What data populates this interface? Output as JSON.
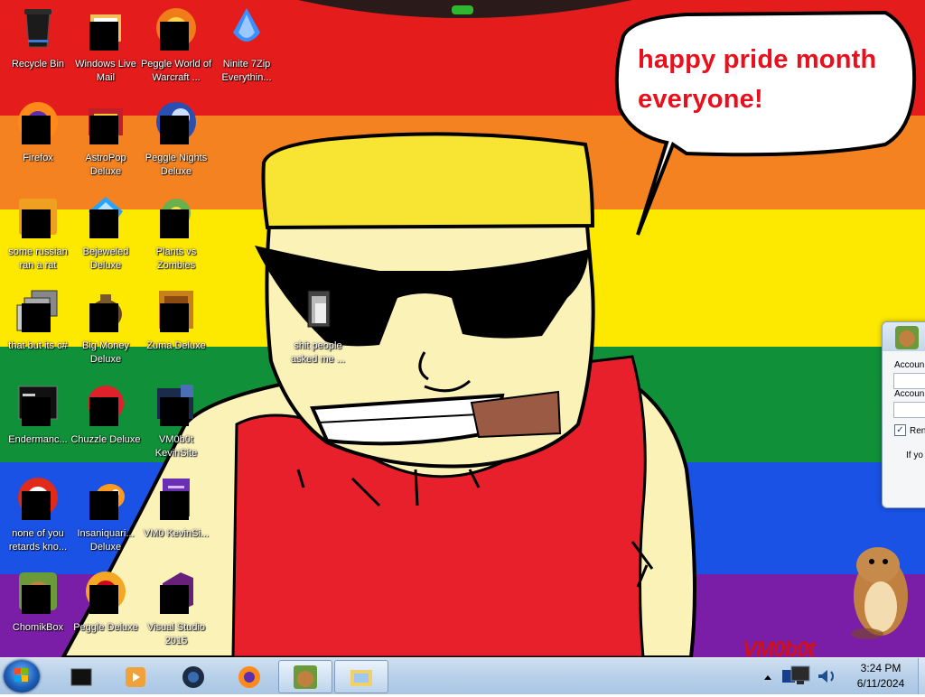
{
  "desktop": {
    "icons": [
      {
        "label": "Recycle Bin",
        "icon": "recycle-bin-icon",
        "masked": false
      },
      {
        "label": "Windows Live Mail",
        "icon": "windows-live-mail-icon",
        "masked": true
      },
      {
        "label": "Peggle World of Warcraft ...",
        "icon": "peggle-wow-icon",
        "masked": true
      },
      {
        "label": "Ninite 7Zip Everythin...",
        "icon": "ninite-icon",
        "masked": false
      },
      {
        "label": "Firefox",
        "icon": "firefox-icon",
        "masked": true
      },
      {
        "label": "AstroPop Deluxe",
        "icon": "astropop-icon",
        "masked": true
      },
      {
        "label": "Peggle Nights Deluxe",
        "icon": "peggle-nights-icon",
        "masked": true
      },
      {
        "label": "some russian ran a rat",
        "icon": "rat-program-icon",
        "masked": true
      },
      {
        "label": "Bejeweled Deluxe",
        "icon": "bejeweled-icon",
        "masked": true
      },
      {
        "label": "Plants vs Zombies",
        "icon": "plants-vs-zombies-icon",
        "masked": true
      },
      {
        "label": "that but its c#",
        "icon": "shortcut-stack-icon",
        "masked": true
      },
      {
        "label": "Big Money Deluxe",
        "icon": "big-money-icon",
        "masked": true
      },
      {
        "label": "Zuma Deluxe",
        "icon": "zuma-icon",
        "masked": true
      },
      {
        "label": "Endermanc...",
        "icon": "terminal-window-icon",
        "masked": true
      },
      {
        "label": "Chuzzle Deluxe",
        "icon": "chuzzle-icon",
        "masked": true
      },
      {
        "label": "VM0b0t KevinSite",
        "icon": "vm0b0t-icon",
        "masked": true
      },
      {
        "label": "none of you retards kno...",
        "icon": "red-circle-app-icon",
        "masked": true
      },
      {
        "label": "Insaniquari... Deluxe",
        "icon": "insaniquarium-icon",
        "masked": true
      },
      {
        "label": "VM0 KevinSi...",
        "icon": "purple-document-icon",
        "masked": true
      },
      {
        "label": "ChomikBox",
        "icon": "chomikbox-icon",
        "masked": true
      },
      {
        "label": "Peggle Deluxe",
        "icon": "peggle-deluxe-icon",
        "masked": true
      },
      {
        "label": "Visual Studio 2015",
        "icon": "visual-studio-icon",
        "masked": true
      },
      {
        "label": "shit people asked me ...",
        "icon": "folder-icon",
        "masked": false
      }
    ]
  },
  "wallpaper": {
    "speech_bubble_text_line1": "happy pride month",
    "speech_bubble_text_line2": "everyone!",
    "signature": "VM0b0t",
    "stripe_colors": [
      "#e41c1c",
      "#f58220",
      "#fde800",
      "#109038",
      "#1a52e6",
      "#7a1ea8"
    ]
  },
  "dialog": {
    "field1_label": "Accoun",
    "field2_label": "Accoun",
    "checkbox_label": "Ren",
    "checkbox_checked": true,
    "footer_text": "If yo"
  },
  "taskbar": {
    "pinned": [
      {
        "name": "taskbar-item-terminal",
        "icon": "black-window-icon"
      },
      {
        "name": "taskbar-item-media-player",
        "icon": "media-player-icon"
      },
      {
        "name": "taskbar-item-generic-app",
        "icon": "dark-globe-icon"
      },
      {
        "name": "taskbar-item-firefox",
        "icon": "firefox-icon"
      },
      {
        "name": "taskbar-item-chomikbox",
        "icon": "chomikbox-icon"
      },
      {
        "name": "taskbar-item-explorer",
        "icon": "explorer-folder-icon"
      }
    ],
    "active_items": [
      "taskbar-item-chomikbox",
      "taskbar-item-explorer"
    ],
    "clock_time": "3:24 PM",
    "clock_date": "6/11/2024",
    "tray_icons": [
      "show-hidden-icons-chevron",
      "network-icon",
      "volume-icon"
    ]
  }
}
